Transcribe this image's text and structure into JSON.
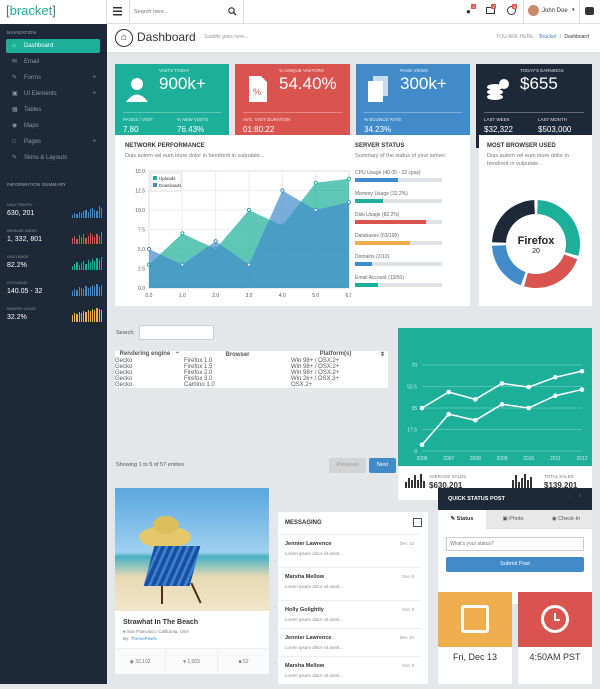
{
  "brand": {
    "left": "[",
    "name": "bracket",
    "right": "]"
  },
  "topbar": {
    "search_placeholder": "Search here...",
    "user_name": "John Doe",
    "badges": [
      "2",
      "2",
      "5"
    ]
  },
  "sidebar": {
    "nav_heading": "NAVIGATION",
    "items": [
      {
        "label": "Dashboard",
        "icon": "home-icon",
        "plus": ""
      },
      {
        "label": "Email",
        "icon": "envelope-icon",
        "plus": ""
      },
      {
        "label": "Forms",
        "icon": "edit-icon",
        "plus": "+"
      },
      {
        "label": "UI Elements",
        "icon": "suitcase-icon",
        "plus": "+"
      },
      {
        "label": "Tables",
        "icon": "table-icon",
        "plus": ""
      },
      {
        "label": "Maps",
        "icon": "map-marker-icon",
        "plus": ""
      },
      {
        "label": "Pages",
        "icon": "file-icon",
        "plus": "+"
      },
      {
        "label": "Skins & Layouts",
        "icon": "brush-icon",
        "plus": ""
      }
    ],
    "info_heading": "INFORMATION SUMMARY",
    "info": [
      {
        "label": "DAILY TRAFFIC",
        "value": "630, 201",
        "color": "#428bca"
      },
      {
        "label": "AVERAGE USERS",
        "value": "1, 332, 801",
        "color": "#d9534f"
      },
      {
        "label": "DISK USAGE",
        "value": "82.2%",
        "color": "#1caf9a"
      },
      {
        "label": "CPU USAGE",
        "value": "140.05 - 32",
        "color": "#428bca"
      },
      {
        "label": "MEMORY USAGE",
        "value": "32.2%",
        "color": "#f0ad4e"
      }
    ]
  },
  "pageheader": {
    "title": "Dashboard",
    "subtitle": "Subtitle goes here...",
    "you_are_here": "YOU ARE HERE:",
    "crumb_link": "Bracket",
    "crumb_current": "Dashboard"
  },
  "stats": [
    {
      "label": "VISITS TODAY",
      "value": "900k+",
      "l1": "PAGES / VISIT",
      "v1": "7.80",
      "l2": "% NEW VISITS",
      "v2": "76.43%",
      "color": "#1caf9a"
    },
    {
      "label": "% UNIQUE VISITORS",
      "value": "54.40%",
      "l1": "AVG. VISIT DURATION",
      "v1": "01:80:22",
      "l2": "",
      "v2": "",
      "color": "#d9534f"
    },
    {
      "label": "PAGE VIEWS",
      "value": "300k+",
      "l1": "% BOUNCE RATE",
      "v1": "34.23%",
      "l2": "",
      "v2": "",
      "color": "#428bca"
    },
    {
      "label": "TODAY'S EARNINGS",
      "value": "$655",
      "l1": "LAST WEEK",
      "v1": "$32,322",
      "l2": "LAST MONTH",
      "v2": "$503,000",
      "color": "#1d2939"
    }
  ],
  "network": {
    "title": "NETWORK PERFORMANCE",
    "text": "Duis autem vel eum iriure dolor in hendrerit in vulputate..."
  },
  "server": {
    "title": "SERVER STATUS",
    "text": "Summary of the status of your server.",
    "items": [
      {
        "label": "CPU Usage (40.05 - 32 cpus)",
        "pct": 0.49,
        "color": "#428bca"
      },
      {
        "label": "Memory Usage (32.2%)",
        "pct": 0.32,
        "color": "#1caf9a"
      },
      {
        "label": "Disk Usage (82.2%)",
        "pct": 0.82,
        "color": "#d9534f"
      },
      {
        "label": "Databases (63/100)",
        "pct": 0.63,
        "color": "#f0ad4e"
      },
      {
        "label": "Domains (2/10)",
        "pct": 0.2,
        "color": "#428bca"
      },
      {
        "label": "Email Account (13/50)",
        "pct": 0.26,
        "color": "#1caf9a"
      }
    ]
  },
  "browser": {
    "title": "MOST BROWSER USED",
    "text": "Duis autem vel eum iriure dolor in hendrerit in vulputate...",
    "center_label": "Firefox",
    "center_value": "20"
  },
  "table": {
    "search_label": "Search:",
    "headers": [
      "Rendering engine",
      "Browser",
      "Platform(s)"
    ],
    "rows": [
      [
        "Gecko",
        "Firefox 1.0",
        "Win 98+ / OSX.2+"
      ],
      [
        "Gecko",
        "Firefox 1.5",
        "Win 98+ / OSX.2+"
      ],
      [
        "Gecko",
        "Firefox 2.0",
        "Win 98+ / OSX.2+"
      ],
      [
        "Gecko",
        "Firefox 3.0",
        "Win 2k+ / OSX.3+"
      ],
      [
        "Gecko",
        "Camino 1.0",
        "OSX.2+"
      ]
    ],
    "info": "Showing 1 to 5 of 57 entries",
    "prev": "Previous",
    "next": "Next"
  },
  "sales": {
    "avg_label": "AVERAGE SALES",
    "avg_value": "$630,201",
    "total_label": "TOTAL SALES",
    "total_value": "$139,201"
  },
  "blog": {
    "title": "Strawhat In The Beach",
    "location": "San Francisco, California, USA",
    "by": "By:",
    "author": "ThemePixels",
    "views": "32,102",
    "likes": "1,003",
    "comments": "52"
  },
  "messaging": {
    "title": "MESSAGING",
    "items": [
      {
        "name": "Jennier Lawrence",
        "date": "Dec 10",
        "text": "Lorem ipsum dolor sit amet..."
      },
      {
        "name": "Marsha Mellow",
        "date": "Dec 9",
        "text": "Lorem ipsum dolor sit amet..."
      },
      {
        "name": "Holly Golightly",
        "date": "Dec 9",
        "text": "Lorem ipsum dolor sit amet..."
      },
      {
        "name": "Jennier Lawrence",
        "date": "Dec 10",
        "text": "Lorem ipsum dolor sit amet..."
      },
      {
        "name": "Marsha Mellow",
        "date": "Dec 9",
        "text": "Lorem ipsum dolor sit amet..."
      }
    ]
  },
  "quickpost": {
    "title": "QUICK STATUS POST",
    "tabs": [
      "Status",
      "Photo",
      "Check-In"
    ],
    "placeholder": "What's your status?",
    "submit": "Submit Post"
  },
  "date_widget": {
    "value": "Fri, Dec 13"
  },
  "time_widget": {
    "value": "4:50AM PST"
  },
  "chart_data": [
    {
      "type": "area",
      "x": [
        0.0,
        1.0,
        2.0,
        3.0,
        4.0,
        5.0,
        6.0
      ],
      "yticks": [
        "0.0",
        "2.5",
        "5.0",
        "7.5",
        "10.0",
        "12.5",
        "15.0"
      ],
      "xticks": [
        "0.0",
        "1.0",
        "2.0",
        "3.0",
        "4.0",
        "5.0",
        "6.0"
      ],
      "ylim": [
        0,
        15
      ],
      "xlim": [
        0,
        6
      ],
      "series": [
        {
          "name": "Uploads",
          "x": [
            0,
            1,
            2,
            3,
            4,
            5,
            6
          ],
          "y": [
            3,
            7,
            5,
            10,
            8,
            13.5,
            14
          ],
          "color": "#1caf9a"
        },
        {
          "name": "Downloads",
          "x": [
            0,
            1,
            2,
            3,
            4,
            5,
            6
          ],
          "y": [
            5,
            3,
            6,
            3,
            12.5,
            10,
            11
          ],
          "color": "#428bca"
        }
      ],
      "legend": "top-left",
      "grid": true
    },
    {
      "type": "pie",
      "subtype": "donut",
      "values": [
        30,
        25,
        20,
        25
      ],
      "colors": [
        "#1caf9a",
        "#d9534f",
        "#428bca",
        "#1d2939"
      ]
    },
    {
      "type": "line",
      "categories": [
        "2006",
        "2007",
        "2008",
        "2009",
        "2010",
        "2011",
        "2012"
      ],
      "yticks": [
        "0",
        "17.5",
        "35",
        "52.5",
        "70"
      ],
      "ylim": [
        0,
        70
      ],
      "series": [
        {
          "x": [
            "2006",
            "2007",
            "2008",
            "2009",
            "2010",
            "2011",
            "2012"
          ],
          "y": [
            35,
            48,
            42,
            55,
            52,
            60,
            65
          ]
        },
        {
          "x": [
            "2006",
            "2007",
            "2008",
            "2009",
            "2010",
            "2011",
            "2012"
          ],
          "y": [
            5,
            30,
            25,
            38,
            35,
            45,
            50
          ]
        }
      ]
    }
  ]
}
